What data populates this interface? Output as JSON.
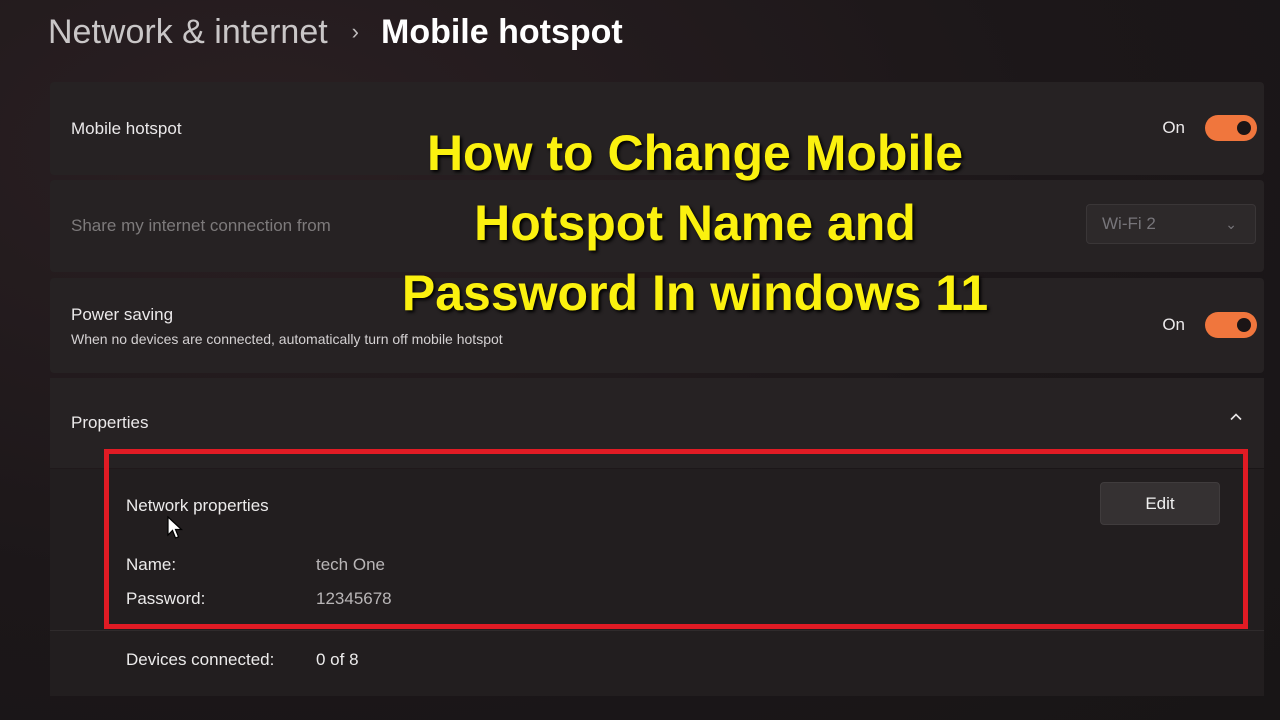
{
  "breadcrumb": {
    "parent": "Network & internet",
    "separator": "›",
    "current": "Mobile hotspot"
  },
  "hotspot": {
    "label": "Mobile hotspot",
    "state": "On"
  },
  "share": {
    "label": "Share my internet connection from",
    "selected": "Wi-Fi 2"
  },
  "power_saving": {
    "label": "Power saving",
    "description": "When no devices are connected, automatically turn off mobile hotspot",
    "state": "On"
  },
  "properties": {
    "label": "Properties",
    "network_properties": "Network properties",
    "edit_label": "Edit",
    "name_label": "Name:",
    "name_value": "tech One",
    "password_label": "Password:",
    "password_value": "12345678",
    "devices_label": "Devices connected:",
    "devices_value": "0 of 8"
  },
  "overlay": {
    "line1": "How to Change Mobile",
    "line2": "Hotspot Name and",
    "line3": "Password In windows 11"
  },
  "colors": {
    "toggle_on": "#f0763d",
    "highlight_box": "#e01b24",
    "overlay_text": "#fbf10f"
  },
  "icons": {
    "caret": "chevron-up-icon",
    "dropdown": "chevron-down-icon",
    "cursor": "mouse-pointer-icon"
  }
}
